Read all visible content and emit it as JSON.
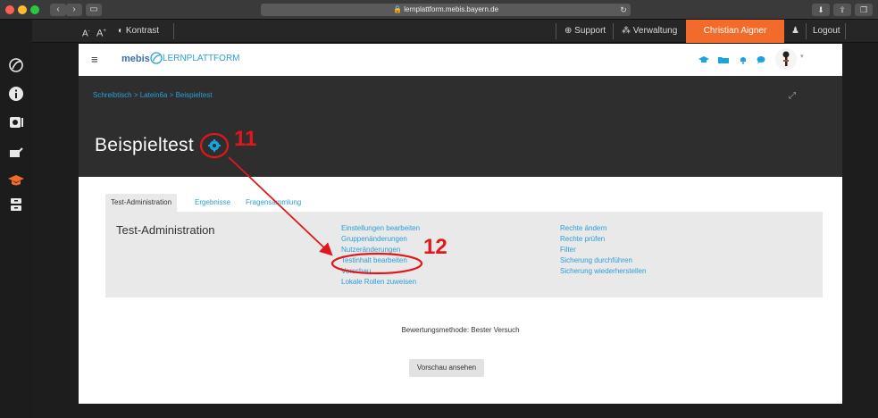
{
  "browser": {
    "url": "lernplattform.mebis.bayern.de"
  },
  "topbar": {
    "font_small": "A",
    "font_large": "A",
    "contrast_label": "Kontrast",
    "support_label": "Support",
    "admin_label": "Verwaltung",
    "user_name": "Christian Aigner",
    "logout_label": "Logout"
  },
  "mebisbar": {
    "logo_main": "mebis",
    "logo_sub": "LERNPLATTFORM"
  },
  "breadcrumb": {
    "items": [
      "Schreibtisch",
      "Latein6a",
      "Beispieltest"
    ],
    "separator": ">"
  },
  "page": {
    "title": "Beispieltest"
  },
  "tabs": [
    {
      "label": "Test-Administration"
    },
    {
      "label": "Ergebnisse"
    },
    {
      "label": "Fragensammlung"
    }
  ],
  "admin": {
    "heading": "Test-Administration",
    "column1": [
      "Einstellungen bearbeiten",
      "Gruppenänderungen",
      "Nutzeränderungen",
      "Testinhalt bearbeiten",
      "Vorschau",
      "Lokale Rollen zuweisen"
    ],
    "column2": [
      "Rechte ändern",
      "Rechte prüfen",
      "Filter",
      "Sicherung durchführen",
      "Sicherung wiederherstellen"
    ]
  },
  "grading": "Bewertungsmethode: Bester Versuch",
  "preview_button": "Vorschau ansehen",
  "annotations": {
    "n1": "11",
    "n2": "12",
    "color": "#e3171b"
  },
  "colors": {
    "accent_orange": "#f26b2a",
    "link_blue": "#2a9fd6"
  }
}
